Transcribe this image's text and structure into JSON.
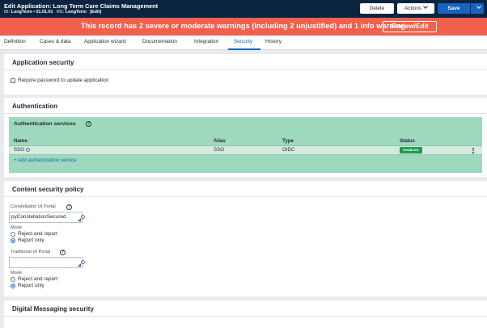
{
  "header": {
    "title": "Edit Application: Long Term Care Claims Management",
    "id_label": "ID:",
    "id_value": "LongTerm • 01.01.01",
    "rs_label": "RS:",
    "rs_value": "LongTerm",
    "edit_tag": "[Edit]",
    "delete_label": "Delete",
    "actions_label": "Actions",
    "save_label": "Save"
  },
  "warning": {
    "message": "This record has 2 severe or moderate warnings (including 2 unjustified) and 1 info warning",
    "button_label": "Review/Edit"
  },
  "tabs": [
    {
      "label": "Definition"
    },
    {
      "label": "Cases & data"
    },
    {
      "label": "Application wizard"
    },
    {
      "label": "Documentation"
    },
    {
      "label": "Integration"
    },
    {
      "label": "Security",
      "active": true
    },
    {
      "label": "History"
    }
  ],
  "app_security": {
    "title": "Application security",
    "require_password_label": "Require password to update application",
    "require_password_checked": false
  },
  "authentication": {
    "title": "Authentication",
    "services_title": "Authentication services",
    "columns": [
      "Name",
      "Alias",
      "Type",
      "Status"
    ],
    "rows": [
      {
        "name": "SSO",
        "alias": "SSO",
        "type": "OIDC",
        "status": "ENABLED"
      }
    ],
    "add_label": "Add authentication service"
  },
  "csp": {
    "title": "Content security policy",
    "constellation_label": "Constellation UI Portal",
    "constellation_value": "pyConstellationSecured",
    "mode_label": "Mode",
    "option_reject": "Reject and report",
    "option_report": "Report only",
    "traditional_label": "Traditional UI Portal",
    "traditional_value": ""
  },
  "messaging": {
    "title": "Digital Messaging security"
  },
  "colors": {
    "header_bg": "#0b2440",
    "warning_bg": "#f1604c",
    "accent": "#1464c0",
    "green_panel": "#9ed8bd",
    "enabled_badge": "#1f9a4b"
  }
}
